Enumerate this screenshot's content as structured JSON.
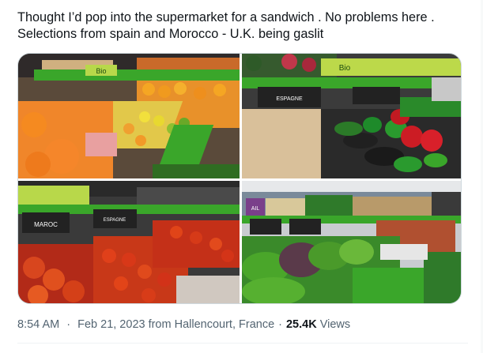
{
  "tweet": {
    "text_line1": "Thought I’d pop into the supermarket for a sandwich . No problems here .",
    "text_line2": "Selections from spain and Morocco - U.K. being gaslit"
  },
  "media": {
    "photo1": {
      "shelf_sign": "Bio"
    },
    "photo2": {
      "shelf_sign": "Bio",
      "price_tag": "ESPAGNE"
    },
    "photo3": {
      "origin_tag": "MAROC",
      "price_tag": "ESPAGNE"
    },
    "photo4": {
      "sign": "AIL"
    }
  },
  "meta": {
    "time": "8:54 AM",
    "separator": "·",
    "date": "Feb 21, 2023",
    "location": "from Hallencourt, France",
    "views_count": "25.4K",
    "views_label": "Views"
  },
  "colors": {
    "text": "#0f1419",
    "secondary": "#536471",
    "border": "#cfd9de",
    "shelf_green": "#3aa62a"
  }
}
